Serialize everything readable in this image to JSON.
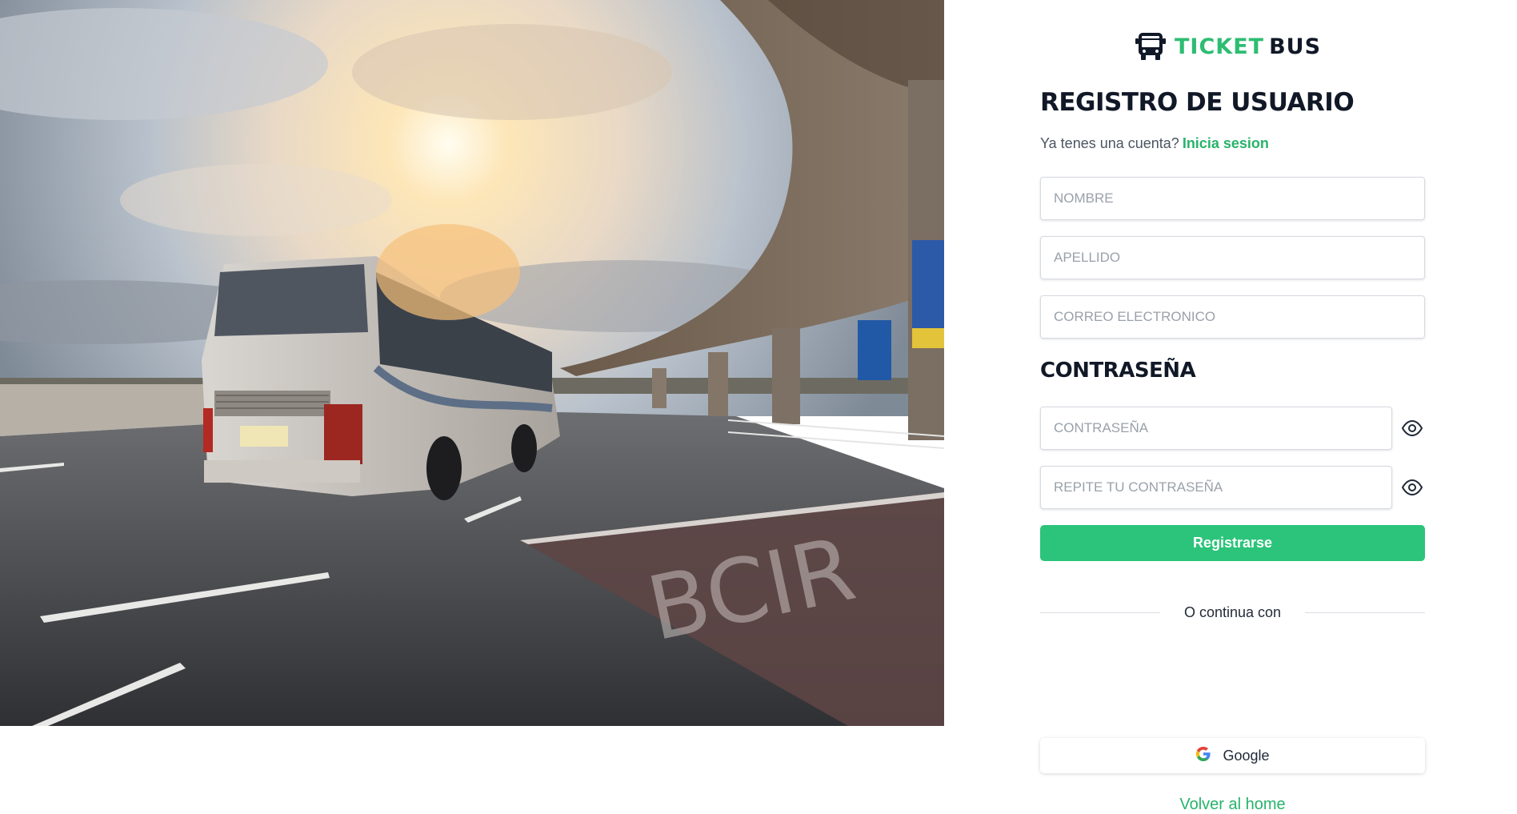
{
  "brand": {
    "part1": "TICKET",
    "part2": "BUS",
    "accent": "#2dbd72"
  },
  "form": {
    "title": "REGISTRO DE USUARIO",
    "have_account": "Ya tenes una cuenta?",
    "login_link": "Inicia sesion",
    "fields": {
      "nombre": "NOMBRE",
      "apellido": "APELLIDO",
      "correo": "CORREO ELECTRONICO"
    },
    "password_title": "CONTRASEÑA",
    "password": {
      "placeholder": "CONTRASEÑA"
    },
    "password_repeat": {
      "placeholder": "REPITE TU CONTRASEÑA"
    },
    "submit_label": "Registrarse",
    "divider_text": "O continua con",
    "google_label": "Google",
    "back_link": "Volver al home"
  },
  "icons": {
    "logo": "bus-icon",
    "password_toggle": "eye-icon",
    "google": "google-icon"
  },
  "colors": {
    "primary_button": "#2bc47a",
    "link": "#27b36a",
    "title": "#111827"
  }
}
